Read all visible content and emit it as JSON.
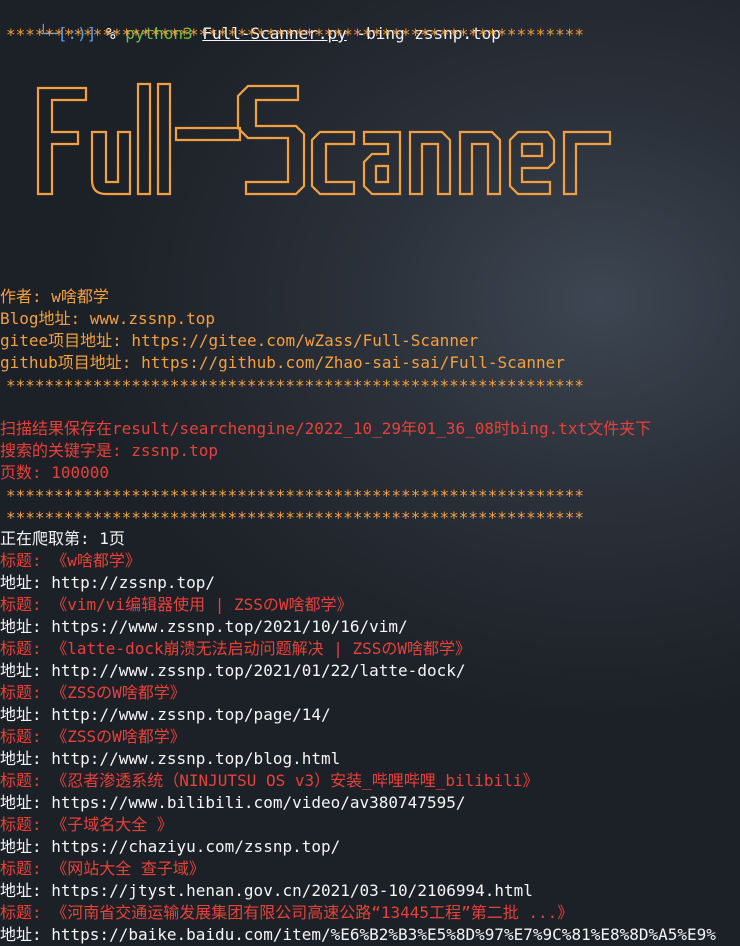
{
  "prompt": {
    "prefix": "└─[:)] ",
    "symbol": "% ",
    "command": "python3",
    "script": "Full-Scanner.py",
    "args": " -bing zssnp.top"
  },
  "separator": "************************************************************",
  "banner": {
    "text": "Full-Scanner",
    "color": "#f5a040"
  },
  "info": {
    "author": "作者: w啥都学",
    "blog": "Blog地址: www.zssnp.top",
    "gitee": "gitee项目地址: https://gitee.com/wZass/Full-Scanner",
    "github": "github项目地址: https://github.com/Zhao-sai-sai/Full-Scanner"
  },
  "scan": {
    "saved": "扫描结果保存在result/searchengine/2022_10_29年01_36_08时bing.txt文件夹下",
    "keyword": "搜索的关键字是: zssnp.top",
    "pages": "页数: 100000"
  },
  "crawl_page": "正在爬取第: 1页",
  "results": [
    {
      "title": "标题: 《w啥都学》",
      "url": "地址: http://zssnp.top/"
    },
    {
      "title": "标题: 《vim/vi编辑器使用 | ZSSのW啥都学》",
      "url": "地址: https://www.zssnp.top/2021/10/16/vim/"
    },
    {
      "title": "标题: 《latte-dock崩溃无法启动问题解决 | ZSSのW啥都学》",
      "url": "地址: http://www.zssnp.top/2021/01/22/latte-dock/"
    },
    {
      "title": "标题: 《ZSSのW啥都学》",
      "url": "地址: http://www.zssnp.top/page/14/"
    },
    {
      "title": "标题: 《ZSSのW啥都学》",
      "url": "地址: http://www.zssnp.top/blog.html"
    },
    {
      "title": "标题: 《忍者渗透系统（NINJUTSU OS v3）安装_哔哩哔哩_bilibili》",
      "url": "地址: https://www.bilibili.com/video/av380747595/"
    },
    {
      "title": "标题: 《子域名大全 》",
      "url": "地址: https://chaziyu.com/zssnp.top/"
    },
    {
      "title": "标题: 《网站大全 查子域》",
      "url": "地址: https://jtyst.henan.gov.cn/2021/03-10/2106994.html"
    },
    {
      "title": "标题: 《河南省交通运输发展集团有限公司高速公路“13445工程”第二批 ...》",
      "url": "地址: https://baike.baidu.com/item/%E6%B2%B3%E5%8D%97%E7%9C%81%E8%8D%A5%E9%"
    }
  ],
  "colors": {
    "orange": "#f5a040",
    "red": "#e8413a",
    "green": "#6cc04a",
    "blue": "#5aa0e6"
  }
}
